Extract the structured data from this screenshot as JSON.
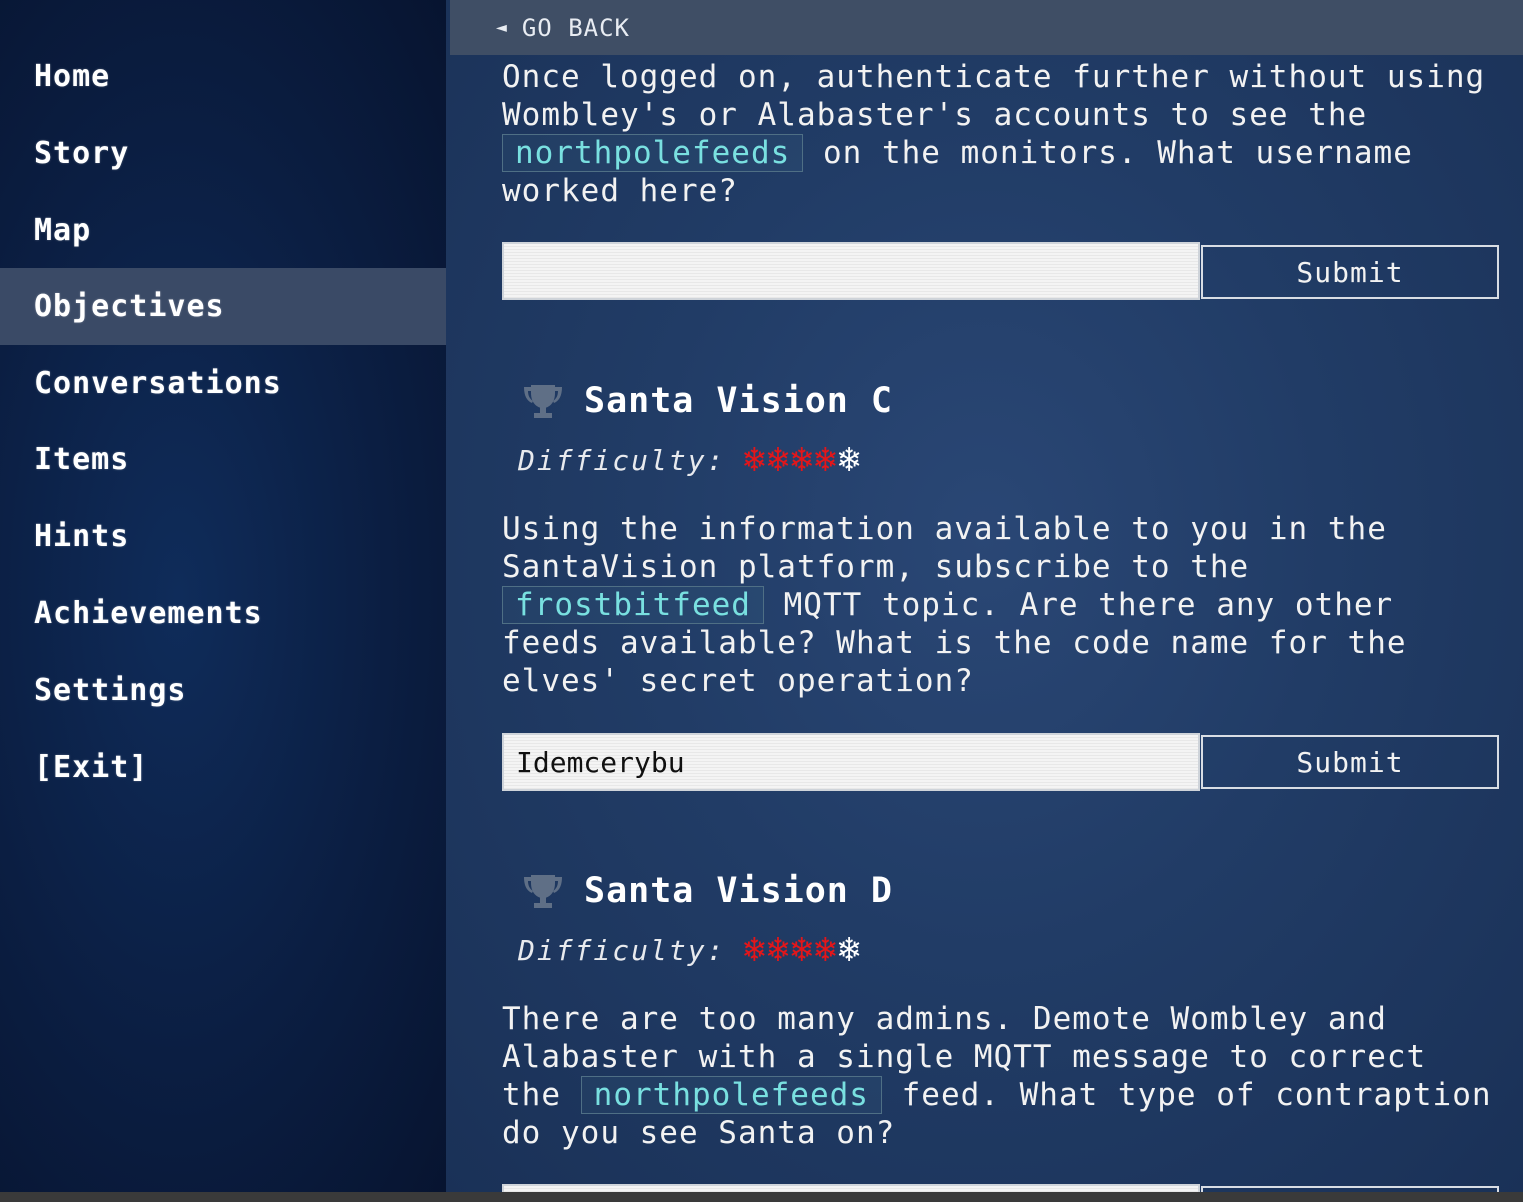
{
  "sidebar": {
    "items": [
      {
        "label": "Home"
      },
      {
        "label": "Story"
      },
      {
        "label": "Map"
      },
      {
        "label": "Objectives"
      },
      {
        "label": "Conversations"
      },
      {
        "label": "Items"
      },
      {
        "label": "Hints"
      },
      {
        "label": "Achievements"
      },
      {
        "label": "Settings"
      },
      {
        "label": "[Exit]"
      }
    ],
    "active": "Objectives"
  },
  "header": {
    "back_icon": "left-triangle-icon",
    "back_label": "GO BACK"
  },
  "objective_b": {
    "text_1": "Once logged on, authenticate further without using Wombley's or Alabaster's accounts to see the",
    "code": "northpolefeeds",
    "text_2": " on the monitors. What username worked here?",
    "answer_value": "",
    "submit_label": "Submit"
  },
  "objective_c": {
    "title": "Santa Vision C",
    "difficulty_label": "Difficulty:",
    "difficulty_level": 4,
    "difficulty_max": 5,
    "text_1": "Using the information available to you in the SantaVision platform, subscribe to the",
    "code": "frostbitfeed",
    "text_2": " MQTT topic. Are there any other feeds available? What is the code name for the elves' secret operation?",
    "answer_value": "Idemcerybu",
    "submit_label": "Submit"
  },
  "objective_d": {
    "title": "Santa Vision D",
    "difficulty_label": "Difficulty:",
    "difficulty_level": 4,
    "difficulty_max": 5,
    "text_1": "There are too many admins. Demote Wombley and Alabaster with a single MQTT message to correct the",
    "code": "northpolefeeds",
    "text_2": " feed. What type of contraption do you see Santa on?",
    "answer_value": ""
  },
  "colors": {
    "flake_on": "#e3161a",
    "flake_off": "#ffffff",
    "code_text": "#79e0e0"
  }
}
